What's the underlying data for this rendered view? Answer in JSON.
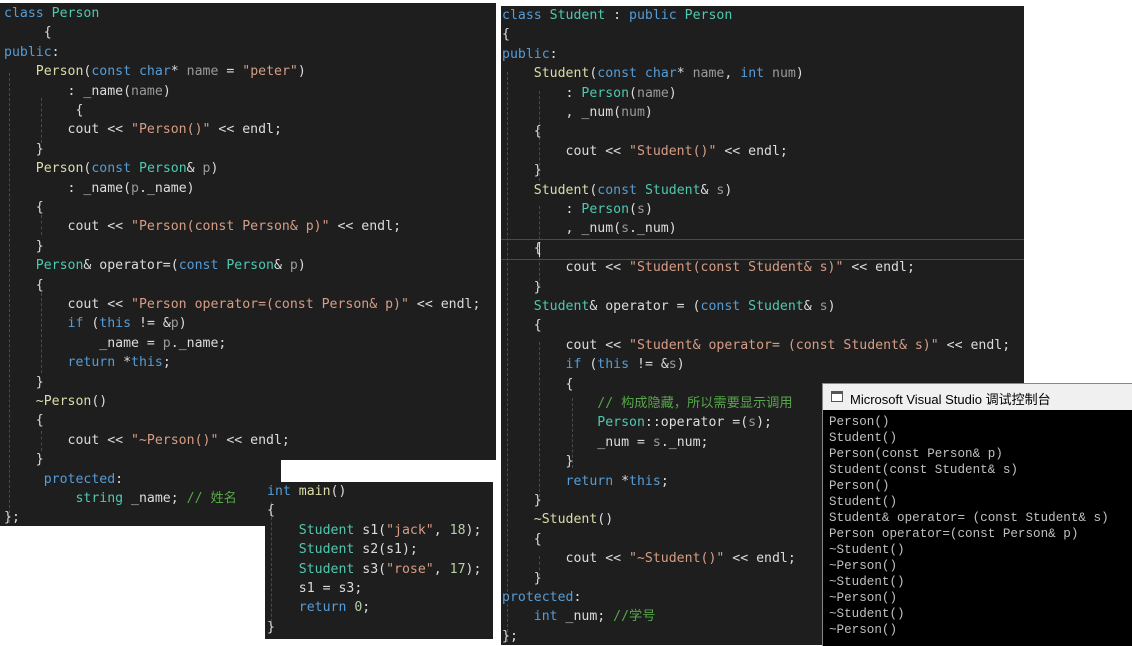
{
  "person_class": {
    "lines": [
      [
        {
          "c": "kw",
          "t": "class "
        },
        {
          "c": "ty",
          "t": "Person"
        }
      ],
      [
        {
          "c": "",
          "t": "     {"
        }
      ],
      [
        {
          "c": "kw",
          "t": "public"
        },
        {
          "c": "",
          "t": ":"
        }
      ],
      [
        {
          "c": "fn",
          "t": "    Person"
        },
        {
          "c": "",
          "t": "("
        },
        {
          "c": "kw",
          "t": "const char"
        },
        {
          "c": "",
          "t": "* "
        },
        {
          "c": "pm",
          "t": "name"
        },
        {
          "c": "",
          "t": " = "
        },
        {
          "c": "st",
          "t": "\"peter\""
        },
        {
          "c": "",
          "t": ")"
        }
      ],
      [
        {
          "c": "",
          "t": "        : _name("
        },
        {
          "c": "pm",
          "t": "name"
        },
        {
          "c": "",
          "t": ")"
        }
      ],
      [
        {
          "c": "",
          "t": "         {"
        }
      ],
      [
        {
          "c": "",
          "t": "        cout << "
        },
        {
          "c": "st",
          "t": "\"Person()\""
        },
        {
          "c": "",
          "t": " << endl;"
        }
      ],
      [
        {
          "c": "",
          "t": "    }"
        }
      ],
      [
        {
          "c": "fn",
          "t": "    Person"
        },
        {
          "c": "",
          "t": "("
        },
        {
          "c": "kw",
          "t": "const "
        },
        {
          "c": "ty",
          "t": "Person"
        },
        {
          "c": "",
          "t": "& "
        },
        {
          "c": "pm",
          "t": "p"
        },
        {
          "c": "",
          "t": ")"
        }
      ],
      [
        {
          "c": "",
          "t": "        : _name("
        },
        {
          "c": "pm",
          "t": "p"
        },
        {
          "c": "",
          "t": "._name)"
        }
      ],
      [
        {
          "c": "",
          "t": "    {"
        }
      ],
      [
        {
          "c": "",
          "t": "        cout << "
        },
        {
          "c": "st",
          "t": "\"Person(const Person& p)\""
        },
        {
          "c": "",
          "t": " << endl;"
        }
      ],
      [
        {
          "c": "",
          "t": "    }"
        }
      ],
      [
        {
          "c": "ty",
          "t": "    Person"
        },
        {
          "c": "",
          "t": "& operator=("
        },
        {
          "c": "kw",
          "t": "const "
        },
        {
          "c": "ty",
          "t": "Person"
        },
        {
          "c": "",
          "t": "& "
        },
        {
          "c": "pm",
          "t": "p"
        },
        {
          "c": "",
          "t": ")"
        }
      ],
      [
        {
          "c": "",
          "t": "    {"
        }
      ],
      [
        {
          "c": "",
          "t": "        cout << "
        },
        {
          "c": "st",
          "t": "\"Person operator=(const Person& p)\""
        },
        {
          "c": "",
          "t": " << endl;"
        }
      ],
      [
        {
          "c": "kw",
          "t": "        if "
        },
        {
          "c": "",
          "t": "("
        },
        {
          "c": "kw",
          "t": "this"
        },
        {
          "c": "",
          "t": " != &"
        },
        {
          "c": "pm",
          "t": "p"
        },
        {
          "c": "",
          "t": ")"
        }
      ],
      [
        {
          "c": "",
          "t": "            _name = "
        },
        {
          "c": "pm",
          "t": "p"
        },
        {
          "c": "",
          "t": "._name;"
        }
      ],
      [
        {
          "c": "kw",
          "t": "        return "
        },
        {
          "c": "",
          "t": "*"
        },
        {
          "c": "kw",
          "t": "this"
        },
        {
          "c": "",
          "t": ";"
        }
      ],
      [
        {
          "c": "",
          "t": "    }"
        }
      ],
      [
        {
          "c": "fn",
          "t": "    ~Person"
        },
        {
          "c": "",
          "t": "()"
        }
      ],
      [
        {
          "c": "",
          "t": "    {"
        }
      ],
      [
        {
          "c": "",
          "t": "        cout << "
        },
        {
          "c": "st",
          "t": "\"~Person()\""
        },
        {
          "c": "",
          "t": " << endl;"
        }
      ],
      [
        {
          "c": "",
          "t": "    }"
        }
      ],
      [
        {
          "c": "kw",
          "t": "     protected"
        },
        {
          "c": "",
          "t": ":"
        }
      ],
      [
        {
          "c": "ty",
          "t": "         string"
        },
        {
          "c": "",
          "t": " _name; "
        },
        {
          "c": "cm",
          "t": "// 姓名"
        }
      ],
      [
        {
          "c": "",
          "t": "};"
        }
      ]
    ]
  },
  "main_function": {
    "lines": [
      [
        {
          "c": "kw",
          "t": "int "
        },
        {
          "c": "fn",
          "t": "main"
        },
        {
          "c": "",
          "t": "()"
        }
      ],
      [
        {
          "c": "",
          "t": "{"
        }
      ],
      [
        {
          "c": "ty",
          "t": "    Student "
        },
        {
          "c": "",
          "t": "s1("
        },
        {
          "c": "st",
          "t": "\"jack\""
        },
        {
          "c": "",
          "t": ", "
        },
        {
          "c": "nm",
          "t": "18"
        },
        {
          "c": "",
          "t": ");"
        }
      ],
      [
        {
          "c": "ty",
          "t": "    Student "
        },
        {
          "c": "",
          "t": "s2(s1);"
        }
      ],
      [
        {
          "c": "ty",
          "t": "    Student "
        },
        {
          "c": "",
          "t": "s3("
        },
        {
          "c": "st",
          "t": "\"rose\""
        },
        {
          "c": "",
          "t": ", "
        },
        {
          "c": "nm",
          "t": "17"
        },
        {
          "c": "",
          "t": ");"
        }
      ],
      [
        {
          "c": "",
          "t": "    s1 = s3;"
        }
      ],
      [
        {
          "c": "kw",
          "t": "    return "
        },
        {
          "c": "nm",
          "t": "0"
        },
        {
          "c": "",
          "t": ";"
        }
      ],
      [
        {
          "c": "",
          "t": "}"
        }
      ]
    ]
  },
  "student_class": {
    "lines": [
      [
        {
          "c": "kw",
          "t": "class "
        },
        {
          "c": "ty",
          "t": "Student"
        },
        {
          "c": "",
          "t": " : "
        },
        {
          "c": "kw",
          "t": "public "
        },
        {
          "c": "ty",
          "t": "Person"
        }
      ],
      [
        {
          "c": "",
          "t": "{"
        }
      ],
      [
        {
          "c": "kw",
          "t": "public"
        },
        {
          "c": "",
          "t": ":"
        }
      ],
      [
        {
          "c": "fn",
          "t": "    Student"
        },
        {
          "c": "",
          "t": "("
        },
        {
          "c": "kw",
          "t": "const char"
        },
        {
          "c": "",
          "t": "* "
        },
        {
          "c": "pm",
          "t": "name"
        },
        {
          "c": "",
          "t": ", "
        },
        {
          "c": "kw",
          "t": "int "
        },
        {
          "c": "pm",
          "t": "num"
        },
        {
          "c": "",
          "t": ")"
        }
      ],
      [
        {
          "c": "",
          "t": "        : "
        },
        {
          "c": "ty",
          "t": "Person"
        },
        {
          "c": "",
          "t": "("
        },
        {
          "c": "pm",
          "t": "name"
        },
        {
          "c": "",
          "t": ")"
        }
      ],
      [
        {
          "c": "",
          "t": "        , _num("
        },
        {
          "c": "pm",
          "t": "num"
        },
        {
          "c": "",
          "t": ")"
        }
      ],
      [
        {
          "c": "",
          "t": "    {"
        }
      ],
      [
        {
          "c": "",
          "t": "        cout << "
        },
        {
          "c": "st",
          "t": "\"Student()\""
        },
        {
          "c": "",
          "t": " << endl;"
        }
      ],
      [
        {
          "c": "",
          "t": "    }"
        }
      ],
      [
        {
          "c": "fn",
          "t": "    Student"
        },
        {
          "c": "",
          "t": "("
        },
        {
          "c": "kw",
          "t": "const "
        },
        {
          "c": "ty",
          "t": "Student"
        },
        {
          "c": "",
          "t": "& "
        },
        {
          "c": "pm",
          "t": "s"
        },
        {
          "c": "",
          "t": ")"
        }
      ],
      [
        {
          "c": "",
          "t": "        : "
        },
        {
          "c": "ty",
          "t": "Person"
        },
        {
          "c": "",
          "t": "("
        },
        {
          "c": "pm",
          "t": "s"
        },
        {
          "c": "",
          "t": ")"
        }
      ],
      [
        {
          "c": "",
          "t": "        , _num("
        },
        {
          "c": "pm",
          "t": "s"
        },
        {
          "c": "",
          "t": "._num)"
        }
      ],
      [
        {
          "c": "",
          "t": "    {"
        }
      ],
      [
        {
          "c": "",
          "t": "        cout << "
        },
        {
          "c": "st",
          "t": "\"Student(const Student& s)\""
        },
        {
          "c": "",
          "t": " << endl;"
        }
      ],
      [
        {
          "c": "",
          "t": "    }"
        }
      ],
      [
        {
          "c": "ty",
          "t": "    Student"
        },
        {
          "c": "",
          "t": "& operator = ("
        },
        {
          "c": "kw",
          "t": "const "
        },
        {
          "c": "ty",
          "t": "Student"
        },
        {
          "c": "",
          "t": "& "
        },
        {
          "c": "pm",
          "t": "s"
        },
        {
          "c": "",
          "t": ")"
        }
      ],
      [
        {
          "c": "",
          "t": "    {"
        }
      ],
      [
        {
          "c": "",
          "t": "        cout << "
        },
        {
          "c": "st",
          "t": "\"Student& operator= (const Student& s)\""
        },
        {
          "c": "",
          "t": " << endl;"
        }
      ],
      [
        {
          "c": "kw",
          "t": "        if "
        },
        {
          "c": "",
          "t": "("
        },
        {
          "c": "kw",
          "t": "this"
        },
        {
          "c": "",
          "t": " != &"
        },
        {
          "c": "pm",
          "t": "s"
        },
        {
          "c": "",
          "t": ")"
        }
      ],
      [
        {
          "c": "",
          "t": "        {"
        }
      ],
      [
        {
          "c": "cm",
          "t": "            // 构成隐藏，所以需要显示调用"
        }
      ],
      [
        {
          "c": "ty",
          "t": "            Person"
        },
        {
          "c": "",
          "t": "::operator =("
        },
        {
          "c": "pm",
          "t": "s"
        },
        {
          "c": "",
          "t": ");"
        }
      ],
      [
        {
          "c": "",
          "t": "            _num = "
        },
        {
          "c": "pm",
          "t": "s"
        },
        {
          "c": "",
          "t": "._num;"
        }
      ],
      [
        {
          "c": "",
          "t": "        }"
        }
      ],
      [
        {
          "c": "kw",
          "t": "        return "
        },
        {
          "c": "",
          "t": "*"
        },
        {
          "c": "kw",
          "t": "this"
        },
        {
          "c": "",
          "t": ";"
        }
      ],
      [
        {
          "c": "",
          "t": "    }"
        }
      ],
      [
        {
          "c": "fn",
          "t": "    ~Student"
        },
        {
          "c": "",
          "t": "()"
        }
      ],
      [
        {
          "c": "",
          "t": "    {"
        }
      ],
      [
        {
          "c": "",
          "t": "        cout << "
        },
        {
          "c": "st",
          "t": "\"~Student()\""
        },
        {
          "c": "",
          "t": " << endl;"
        }
      ],
      [
        {
          "c": "",
          "t": "    }"
        }
      ],
      [
        {
          "c": "kw",
          "t": "protected"
        },
        {
          "c": "",
          "t": ":"
        }
      ],
      [
        {
          "c": "kw",
          "t": "    int "
        },
        {
          "c": "",
          "t": "_num; "
        },
        {
          "c": "cm",
          "t": "//学号"
        }
      ],
      [
        {
          "c": "",
          "t": "};"
        }
      ]
    ]
  },
  "console": {
    "title": "Microsoft Visual Studio 调试控制台",
    "output": [
      "Person()",
      "Student()",
      "Person(const Person& p)",
      "Student(const Student& s)",
      "Person()",
      "Student()",
      "Student& operator= (const Student& s)",
      "Person operator=(const Person& p)",
      "~Student()",
      "~Person()",
      "~Student()",
      "~Person()",
      "~Student()",
      "~Person()"
    ]
  }
}
